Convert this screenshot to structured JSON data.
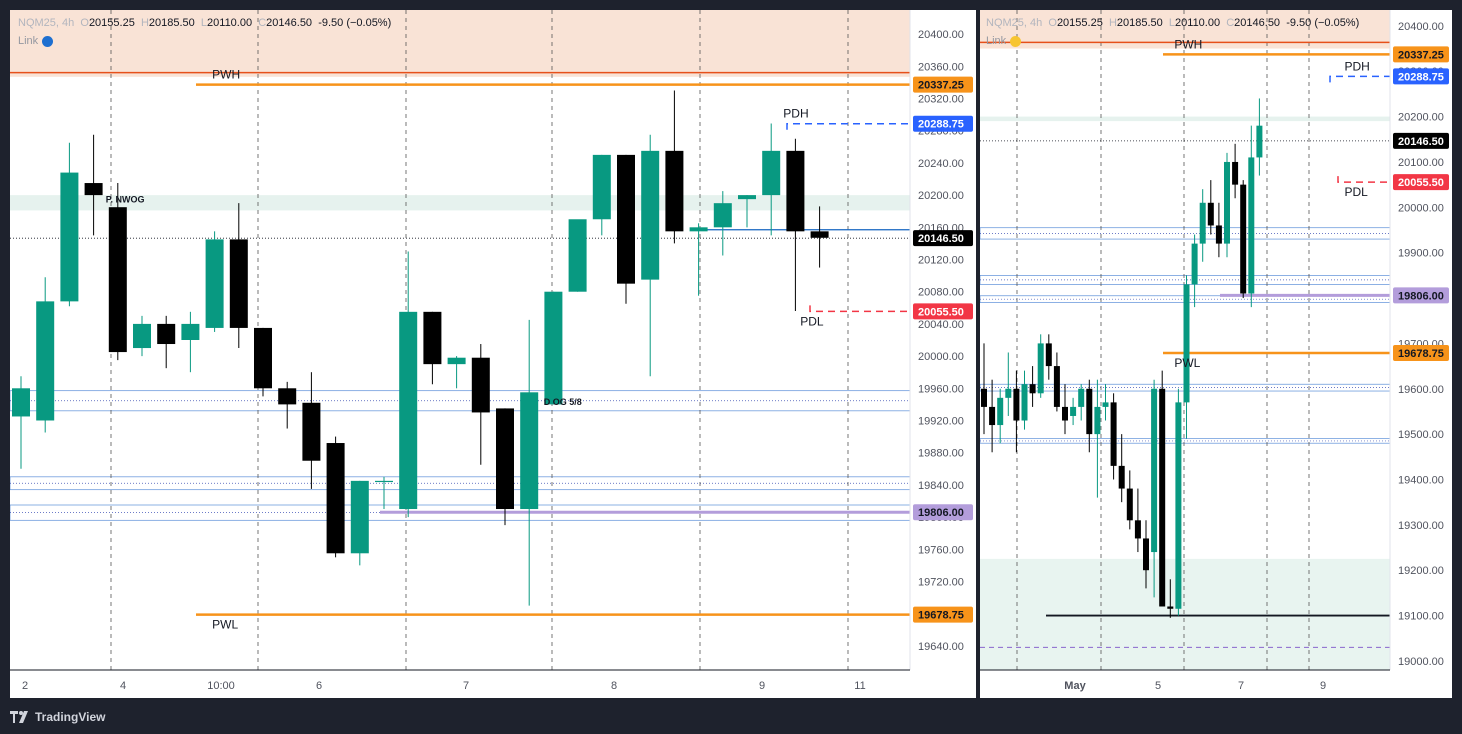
{
  "app": {
    "brand": "TradingView"
  },
  "panels": [
    {
      "id": "left",
      "symbol": "NQM25, 4h",
      "ohlc": {
        "o": "20155.25",
        "h": "20185.50",
        "l": "20110.00",
        "c": "20146.50",
        "change": "-9.50 (−0.05%)"
      },
      "link_label": "Link",
      "link_color": "#1e6fd0",
      "x_ticks": [
        "2",
        "4",
        "10:00",
        "6",
        "7",
        "8",
        "9",
        "11"
      ],
      "y_ticks": [
        "20400.00",
        "20360.00",
        "20320.00",
        "20280.00",
        "20240.00",
        "20200.00",
        "20160.00",
        "20120.00",
        "20080.00",
        "20040.00",
        "20000.00",
        "19960.00",
        "19920.00",
        "19880.00",
        "19840.00",
        "19800.00",
        "19760.00",
        "19720.00",
        "19680.00",
        "19640.00"
      ],
      "price_labels": [
        {
          "text": "20337.25",
          "value": 20337.25,
          "color": "#f7931a",
          "text_color": "#131722"
        },
        {
          "text": "20288.75",
          "value": 20288.75,
          "color": "#2962ff",
          "text_color": "#ffffff"
        },
        {
          "text": "20146.50",
          "value": 20146.5,
          "color": "#000000",
          "text_color": "#ffffff"
        },
        {
          "text": "20055.50",
          "value": 20055.5,
          "color": "#f23645",
          "text_color": "#ffffff"
        },
        {
          "text": "19806.00",
          "value": 19806.0,
          "color": "#b39ddb",
          "text_color": "#131722"
        },
        {
          "text": "19678.75",
          "value": 19678.75,
          "color": "#f7931a",
          "text_color": "#131722"
        }
      ],
      "annotations": [
        {
          "text": "PWH",
          "value": 20337.25,
          "bar": 7.9
        },
        {
          "text": "PDH",
          "value": 20288.75,
          "bar": 31.5
        },
        {
          "text": "P. NWOG",
          "value": 20196,
          "bar": 3.5
        },
        {
          "text": "PDL",
          "value": 20055.5,
          "bar": 32.2
        },
        {
          "text": "D OG 5/8",
          "value": 19944,
          "bar": 21.6
        },
        {
          "text": "PWL",
          "value": 19678.75,
          "bar": 7.9
        }
      ]
    },
    {
      "id": "right",
      "symbol": "NQM25, 4h",
      "ohlc": {
        "o": "20155.25",
        "h": "20185.50",
        "l": "20110.00",
        "c": "20146.50",
        "change": "-9.50 (−0.05%)"
      },
      "link_label": "Link",
      "link_color": "#f7c531",
      "x_ticks": [
        "May",
        "5",
        "7",
        "9"
      ],
      "y_ticks": [
        "20400.00",
        "20300.00",
        "20200.00",
        "20100.00",
        "20000.00",
        "19900.00",
        "19800.00",
        "19700.00",
        "19600.00",
        "19500.00",
        "19400.00",
        "19300.00",
        "19200.00",
        "19100.00",
        "19000.00"
      ],
      "price_labels": [
        {
          "text": "20337.25",
          "value": 20337.25,
          "color": "#f7931a",
          "text_color": "#131722"
        },
        {
          "text": "20288.75",
          "value": 20288.75,
          "color": "#2962ff",
          "text_color": "#ffffff"
        },
        {
          "text": "20146.50",
          "value": 20146.5,
          "color": "#000000",
          "text_color": "#ffffff"
        },
        {
          "text": "20055.50",
          "value": 20055.5,
          "color": "#f23645",
          "text_color": "#ffffff"
        },
        {
          "text": "19806.00",
          "value": 19806.0,
          "color": "#b39ddb",
          "text_color": "#131722"
        },
        {
          "text": "19678.75",
          "value": 19678.75,
          "color": "#f7931a",
          "text_color": "#131722"
        }
      ],
      "annotations": [
        {
          "text": "PWH",
          "value": 20337.25,
          "bar": 23.5
        },
        {
          "text": "PDH",
          "value": 20288.75,
          "bar": 44.5
        },
        {
          "text": "PDL",
          "value": 20055.5,
          "bar": 44.5
        },
        {
          "text": "PWL",
          "value": 19678.75,
          "bar": 23.5
        }
      ]
    }
  ],
  "chart_data": [
    {
      "type": "candlestick",
      "title": "NQM25, 4h",
      "ylim": [
        19610,
        20430
      ],
      "candles": [
        {
          "o": 19925,
          "h": 19975,
          "l": 19860,
          "c": 19960
        },
        {
          "o": 19920,
          "h": 20098,
          "l": 19905,
          "c": 20068
        },
        {
          "o": 20068,
          "h": 20265,
          "l": 20062,
          "c": 20228
        },
        {
          "o": 20215,
          "h": 20275,
          "l": 20150,
          "c": 20200
        },
        {
          "o": 20185,
          "h": 20215,
          "l": 19995,
          "c": 20005
        },
        {
          "o": 20010,
          "h": 20050,
          "l": 20000,
          "c": 20040
        },
        {
          "o": 20040,
          "h": 20050,
          "l": 19985,
          "c": 20015
        },
        {
          "o": 20020,
          "h": 20055,
          "l": 19980,
          "c": 20040
        },
        {
          "o": 20035,
          "h": 20155,
          "l": 20030,
          "c": 20145
        },
        {
          "o": 20145,
          "h": 20190,
          "l": 20010,
          "c": 20035
        },
        {
          "o": 20035,
          "h": 20035,
          "l": 19950,
          "c": 19960
        },
        {
          "o": 19960,
          "h": 19968,
          "l": 19910,
          "c": 19940
        },
        {
          "o": 19942,
          "h": 19980,
          "l": 19835,
          "c": 19870
        },
        {
          "o": 19892,
          "h": 19900,
          "l": 19750,
          "c": 19755
        },
        {
          "o": 19755,
          "h": 19845,
          "l": 19740,
          "c": 19845
        },
        {
          "o": 19845,
          "h": 19850,
          "l": 19810,
          "c": 19845
        },
        {
          "o": 19810,
          "h": 20130,
          "l": 19800,
          "c": 20055
        },
        {
          "o": 20055,
          "h": 20055,
          "l": 19965,
          "c": 19990
        },
        {
          "o": 19990,
          "h": 20000,
          "l": 19960,
          "c": 19998
        },
        {
          "o": 19998,
          "h": 20015,
          "l": 19865,
          "c": 19930
        },
        {
          "o": 19935,
          "h": 19935,
          "l": 19790,
          "c": 19810
        },
        {
          "o": 19810,
          "h": 20045,
          "l": 19690,
          "c": 19955
        },
        {
          "o": 19940,
          "h": 20080,
          "l": 19940,
          "c": 20080
        },
        {
          "o": 20080,
          "h": 20140,
          "l": 20080,
          "c": 20170
        },
        {
          "o": 20170,
          "h": 20250,
          "l": 20150,
          "c": 20250
        },
        {
          "o": 20250,
          "h": 20250,
          "l": 20065,
          "c": 20090
        },
        {
          "o": 20095,
          "h": 20275,
          "l": 19975,
          "c": 20255
        },
        {
          "o": 20255,
          "h": 20330,
          "l": 20140,
          "c": 20155
        },
        {
          "o": 20155,
          "h": 20165,
          "l": 20075,
          "c": 20160
        },
        {
          "o": 20160,
          "h": 20205,
          "l": 20125,
          "c": 20190
        },
        {
          "o": 20195,
          "h": 20200,
          "l": 20160,
          "c": 20200
        },
        {
          "o": 20200,
          "h": 20289,
          "l": 20150,
          "c": 20255
        },
        {
          "o": 20255,
          "h": 20270,
          "l": 20056,
          "c": 20155
        },
        {
          "o": 20155,
          "h": 20186,
          "l": 20110,
          "c": 20147
        }
      ],
      "lines": [
        {
          "label": "PWH",
          "value": 20337.25
        },
        {
          "label": "PDH",
          "value": 20288.75
        },
        {
          "label": "Last",
          "value": 20146.5
        },
        {
          "label": "PDL",
          "value": 20055.5
        },
        {
          "label": "19806.00",
          "value": 19806.0
        },
        {
          "label": "PWL",
          "value": 19678.75
        }
      ],
      "xlabel": "",
      "ylabel": ""
    },
    {
      "type": "candlestick",
      "title": "NQM25, 4h",
      "ylim": [
        18980,
        20435
      ],
      "candles": [
        {
          "o": 19600,
          "h": 19700,
          "l": 19500,
          "c": 19560
        },
        {
          "o": 19560,
          "h": 19620,
          "l": 19460,
          "c": 19520
        },
        {
          "o": 19520,
          "h": 19600,
          "l": 19480,
          "c": 19580
        },
        {
          "o": 19580,
          "h": 19680,
          "l": 19540,
          "c": 19600
        },
        {
          "o": 19600,
          "h": 19640,
          "l": 19460,
          "c": 19530
        },
        {
          "o": 19530,
          "h": 19640,
          "l": 19510,
          "c": 19610
        },
        {
          "o": 19610,
          "h": 19650,
          "l": 19560,
          "c": 19590
        },
        {
          "o": 19590,
          "h": 19720,
          "l": 19580,
          "c": 19700
        },
        {
          "o": 19700,
          "h": 19720,
          "l": 19620,
          "c": 19650
        },
        {
          "o": 19650,
          "h": 19680,
          "l": 19550,
          "c": 19560
        },
        {
          "o": 19560,
          "h": 19610,
          "l": 19500,
          "c": 19530
        },
        {
          "o": 19540,
          "h": 19580,
          "l": 19520,
          "c": 19560
        },
        {
          "o": 19560,
          "h": 19610,
          "l": 19530,
          "c": 19600
        },
        {
          "o": 19600,
          "h": 19620,
          "l": 19460,
          "c": 19500
        },
        {
          "o": 19500,
          "h": 19620,
          "l": 19360,
          "c": 19560
        },
        {
          "o": 19560,
          "h": 19610,
          "l": 19530,
          "c": 19570
        },
        {
          "o": 19570,
          "h": 19590,
          "l": 19400,
          "c": 19430
        },
        {
          "o": 19430,
          "h": 19500,
          "l": 19350,
          "c": 19380
        },
        {
          "o": 19380,
          "h": 19420,
          "l": 19290,
          "c": 19310
        },
        {
          "o": 19310,
          "h": 19380,
          "l": 19240,
          "c": 19270
        },
        {
          "o": 19270,
          "h": 19310,
          "l": 19160,
          "c": 19200
        },
        {
          "o": 19240,
          "h": 19620,
          "l": 19140,
          "c": 19600
        },
        {
          "o": 19600,
          "h": 19640,
          "l": 19120,
          "c": 19120
        },
        {
          "o": 19120,
          "h": 19180,
          "l": 19095,
          "c": 19115
        },
        {
          "o": 19115,
          "h": 19600,
          "l": 19100,
          "c": 19570
        },
        {
          "o": 19570,
          "h": 19850,
          "l": 19490,
          "c": 19830
        },
        {
          "o": 19830,
          "h": 19940,
          "l": 19780,
          "c": 19920
        },
        {
          "o": 19920,
          "h": 20040,
          "l": 19880,
          "c": 20010
        },
        {
          "o": 20010,
          "h": 20060,
          "l": 19940,
          "c": 19960
        },
        {
          "o": 19960,
          "h": 20010,
          "l": 19890,
          "c": 19920
        },
        {
          "o": 19920,
          "h": 20120,
          "l": 19890,
          "c": 20100
        },
        {
          "o": 20100,
          "h": 20140,
          "l": 20020,
          "c": 20050
        },
        {
          "o": 20050,
          "h": 20060,
          "l": 19800,
          "c": 19810
        },
        {
          "o": 19810,
          "h": 20180,
          "l": 19780,
          "c": 20110
        },
        {
          "o": 20110,
          "h": 20240,
          "l": 20070,
          "c": 20180
        }
      ],
      "lines": [
        {
          "label": "PWH",
          "value": 20337.25
        },
        {
          "label": "PDH",
          "value": 20288.75
        },
        {
          "label": "Last",
          "value": 20146.5
        },
        {
          "label": "PDL",
          "value": 20055.5
        },
        {
          "label": "19806.00",
          "value": 19806.0
        },
        {
          "label": "PWL",
          "value": 19678.75
        }
      ],
      "xlabel": "",
      "ylabel": ""
    }
  ]
}
